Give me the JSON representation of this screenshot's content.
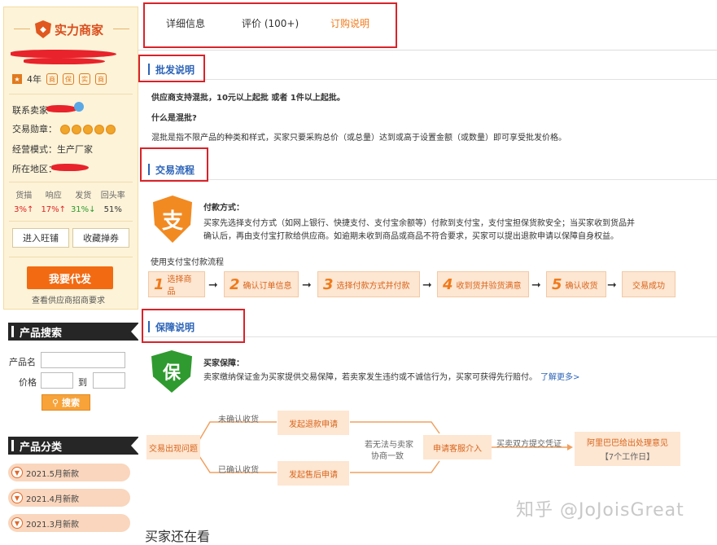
{
  "sidebar": {
    "brand": "实力商家",
    "years": "4年",
    "badges": [
      "商",
      "保",
      "实",
      "商"
    ],
    "contact_label": "联系卖家",
    "medal_label": "交易勋章",
    "model": "经营模式：生产厂家",
    "region_label": "所在地区：",
    "stats": {
      "headers": [
        "货描",
        "响应",
        "发货",
        "回头率"
      ],
      "values": [
        "3%↑",
        "17%↑",
        "31%↓",
        "51%"
      ]
    },
    "enter_shop": "进入旺铺",
    "favorite": "收藏掸券",
    "agent_button": "我要代发",
    "agent_sub": "查看供应商招商要求",
    "search": {
      "title": "产品搜索",
      "name_label": "产品名",
      "price_label": "价格",
      "to_label": "到",
      "button": "搜索"
    },
    "categories": {
      "title": "产品分类",
      "items": [
        "2021.5月新款",
        "2021.4月新款",
        "2021.3月新款"
      ]
    }
  },
  "tabs": [
    "详细信息",
    "评价 (100+)",
    "订购说明"
  ],
  "wholesale": {
    "title": "批发说明",
    "line1": "供应商支持混批，10元以上起批 或者 1件以上起批。",
    "question": "什么是混批?",
    "answer": "混批是指不限产品的种类和样式，买家只要采购总价（或总量）达到或高于设置金额（或数量）即可享受批发价格。"
  },
  "process": {
    "title": "交易流程",
    "pay_icon": "支",
    "pay_title": "付款方式：",
    "pay_text1": "买家先选择支付方式（如网上银行、快捷支付、支付宝余额等）付款到支付宝，支付宝担保货款安全；当买家收到货品并",
    "pay_text2": "确认后，再由支付宝打款给供应商。如逾期未收到商品或商品不符合要求，买家可以提出退款申请以保障自身权益。",
    "flow_title": "使用支付宝付款流程",
    "steps": [
      {
        "n": "1",
        "label": "选择商品"
      },
      {
        "n": "2",
        "label": "确认订单信息"
      },
      {
        "n": "3",
        "label": "选择付款方式并付款"
      },
      {
        "n": "4",
        "label": "收到货并验货满意"
      },
      {
        "n": "5",
        "label": "确认收货"
      },
      {
        "n": "",
        "label": "交易成功"
      }
    ]
  },
  "guarantee": {
    "title": "保障说明",
    "icon": "保",
    "buyer_title": "买家保障：",
    "buyer_text": "卖家缴纳保证金为买家提供交易保障，若卖家发生违约或不诚信行为，买家可获得先行赔付。",
    "learn_more": "了解更多>",
    "flow": {
      "problem": "交易出现问题",
      "unconfirmed": "未确认收货",
      "refund": "发起退款申请",
      "confirmed": "已确认收货",
      "after_sale": "发起售后申请",
      "no_agreement": "若无法与卖家",
      "negotiate": "协商一致",
      "service": "申请客服介入",
      "evidence": "买卖双方提交凭证",
      "result1": "阿里巴巴给出处理意见",
      "result2": "【7个工作日】"
    }
  },
  "footer_partial": "买家还在看",
  "watermark": "知乎 @JoJoisGreat"
}
